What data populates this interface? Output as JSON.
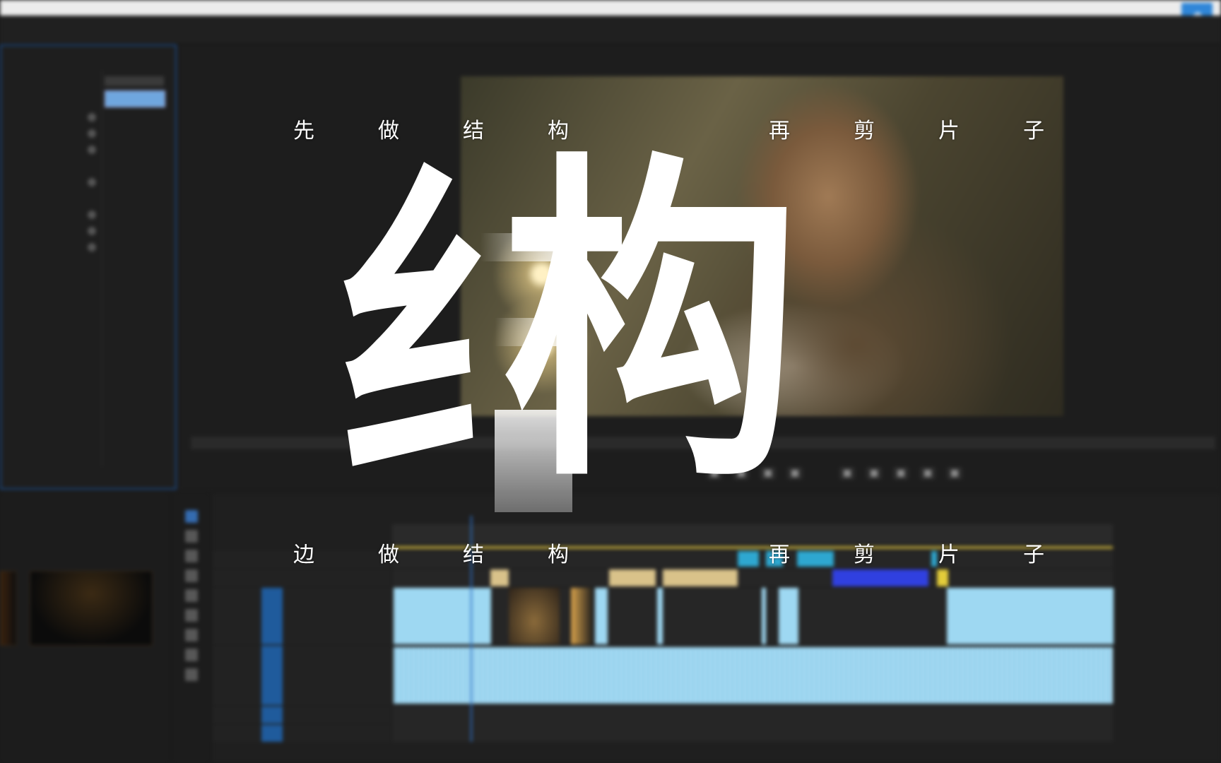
{
  "overlay": {
    "top_row": [
      "先",
      "做",
      "结",
      "构",
      "再",
      "剪",
      "片",
      "子"
    ],
    "bottom_row": [
      "边",
      "做",
      "结",
      "构",
      "再",
      "剪",
      "片",
      "子"
    ],
    "big_chars": [
      "纟",
      "构"
    ]
  },
  "colors": {
    "accent_blue": "#3b7fd6",
    "video_clip": "#9ed8f2",
    "audio_clip": "#a6dcf4",
    "graphic_clip": "#d9c28a",
    "work_area": "#b7a23c"
  },
  "icons": {
    "cloud": "cloud-icon",
    "selection_tool": "selection-tool-icon",
    "type_tool": "type-tool-icon",
    "play": "play-icon"
  }
}
